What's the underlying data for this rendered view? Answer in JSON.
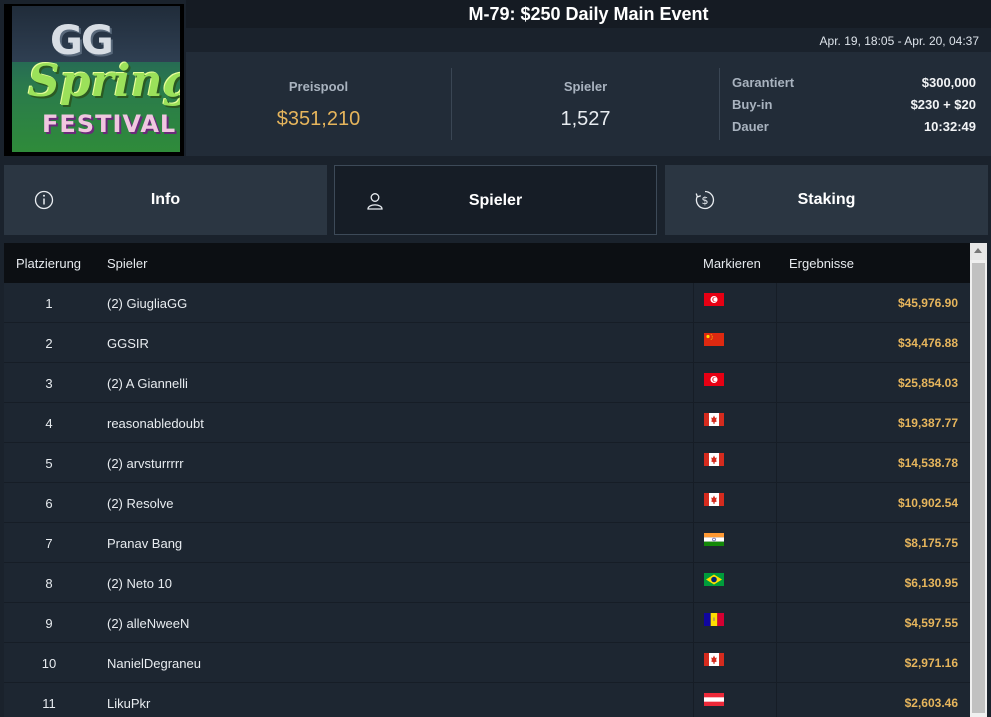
{
  "logo": {
    "line1": "GG",
    "line2": "Spring",
    "line3": "FESTIVAL"
  },
  "event": {
    "title": "M-79: $250 Daily Main Event",
    "date_range": "Apr. 19, 18:05 - Apr. 20, 04:37"
  },
  "stats": {
    "prizepool_label": "Preispool",
    "prizepool_value": "$351,210",
    "players_label": "Spieler",
    "players_value": "1,527",
    "guaranteed_label": "Garantiert",
    "guaranteed_value": "$300,000",
    "buyin_label": "Buy-in",
    "buyin_value": "$230 + $20",
    "duration_label": "Dauer",
    "duration_value": "10:32:49"
  },
  "tabs": [
    {
      "label": "Info",
      "icon": "info-icon"
    },
    {
      "label": "Spieler",
      "icon": "user-icon"
    },
    {
      "label": "Staking",
      "icon": "dollar-refresh-icon"
    }
  ],
  "colors": {
    "accent": "#e6b55c",
    "background": "#1a222c"
  },
  "table": {
    "headers": {
      "rank": "Platzierung",
      "player": "Spieler",
      "mark": "Markieren",
      "results": "Ergebnisse"
    },
    "rows": [
      {
        "rank": "1",
        "name": "(2) GiugliaGG",
        "flag": "tunisia",
        "result": "$45,976.90"
      },
      {
        "rank": "2",
        "name": "GGSIR",
        "flag": "china",
        "result": "$34,476.88"
      },
      {
        "rank": "3",
        "name": "(2) A Giannelli",
        "flag": "tunisia",
        "result": "$25,854.03"
      },
      {
        "rank": "4",
        "name": "reasonabledoubt",
        "flag": "canada",
        "result": "$19,387.77"
      },
      {
        "rank": "5",
        "name": "(2) arvsturrrrr",
        "flag": "canada",
        "result": "$14,538.78"
      },
      {
        "rank": "6",
        "name": "(2) Resolve",
        "flag": "canada",
        "result": "$10,902.54"
      },
      {
        "rank": "7",
        "name": "Pranav Bang",
        "flag": "india",
        "result": "$8,175.75"
      },
      {
        "rank": "8",
        "name": "(2) Neto 10",
        "flag": "brazil",
        "result": "$6,130.95"
      },
      {
        "rank": "9",
        "name": "(2) alleNweeN",
        "flag": "andorra",
        "result": "$4,597.55"
      },
      {
        "rank": "10",
        "name": "NanielDegraneu",
        "flag": "canada",
        "result": "$2,971.16"
      },
      {
        "rank": "11",
        "name": "LikuPkr",
        "flag": "austria",
        "result": "$2,603.46"
      }
    ]
  }
}
